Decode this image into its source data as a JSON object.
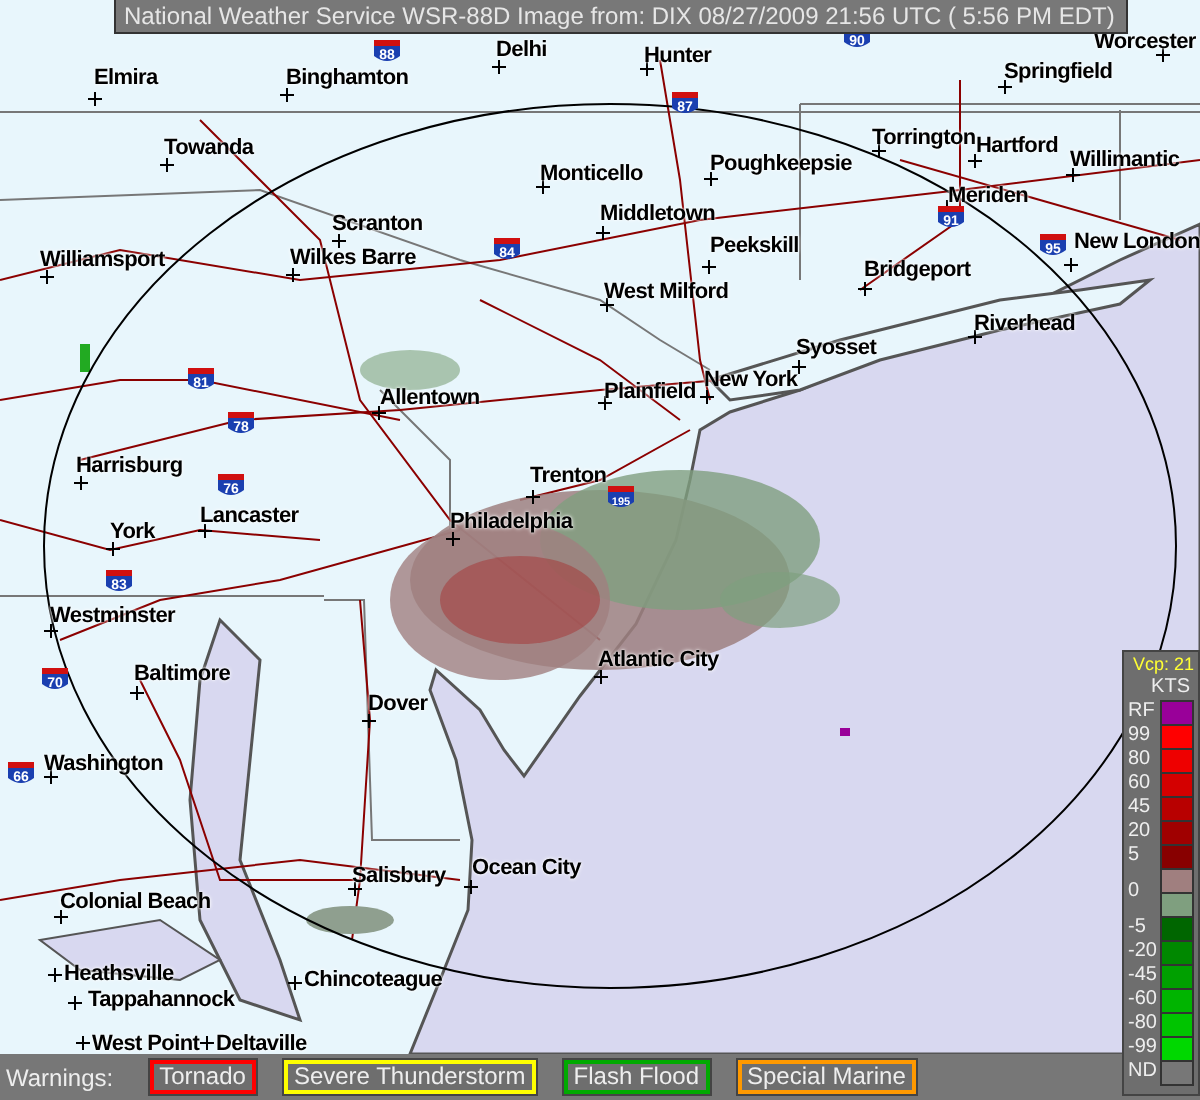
{
  "header": {
    "title": "National Weather Service WSR-88D Image from: DIX 08/27/2009 21:56 UTC ( 5:56 PM EDT)"
  },
  "map": {
    "cities": [
      {
        "name": "Elmira"
      },
      {
        "name": "Binghamton"
      },
      {
        "name": "Delhi"
      },
      {
        "name": "Hunter"
      },
      {
        "name": "Worcester"
      },
      {
        "name": "Springfield"
      },
      {
        "name": "Towanda"
      },
      {
        "name": "Monticello"
      },
      {
        "name": "Poughkeepsie"
      },
      {
        "name": "Torrington"
      },
      {
        "name": "Hartford"
      },
      {
        "name": "Willimantic"
      },
      {
        "name": "Meriden"
      },
      {
        "name": "Middletown"
      },
      {
        "name": "New London"
      },
      {
        "name": "Peekskill"
      },
      {
        "name": "Bridgeport"
      },
      {
        "name": "Riverhead"
      },
      {
        "name": "Scranton"
      },
      {
        "name": "Williamsport"
      },
      {
        "name": "Wilkes Barre"
      },
      {
        "name": "West Milford"
      },
      {
        "name": "Syosset"
      },
      {
        "name": "New York"
      },
      {
        "name": "Plainfield"
      },
      {
        "name": "Allentown"
      },
      {
        "name": "Trenton"
      },
      {
        "name": "Harrisburg"
      },
      {
        "name": "Lancaster"
      },
      {
        "name": "York"
      },
      {
        "name": "Philadelphia"
      },
      {
        "name": "Westminster"
      },
      {
        "name": "Atlantic City"
      },
      {
        "name": "Baltimore"
      },
      {
        "name": "Dover"
      },
      {
        "name": "Washington"
      },
      {
        "name": "Salisbury"
      },
      {
        "name": "Ocean City"
      },
      {
        "name": "Colonial Beach"
      },
      {
        "name": "Chincoteague"
      },
      {
        "name": "Heathsville"
      },
      {
        "name": "Tappahannock"
      },
      {
        "name": "West Point"
      },
      {
        "name": "Deltaville"
      }
    ],
    "shields": [
      {
        "number": "88"
      },
      {
        "number": "90"
      },
      {
        "number": "87"
      },
      {
        "number": "84"
      },
      {
        "number": "91"
      },
      {
        "number": "95"
      },
      {
        "number": "81"
      },
      {
        "number": "78"
      },
      {
        "number": "76"
      },
      {
        "number": "83"
      },
      {
        "number": "70"
      },
      {
        "number": "66"
      },
      {
        "number": "195"
      }
    ]
  },
  "legend": {
    "mode": "Vcp: 21",
    "unit": "KTS",
    "items": [
      {
        "label": "RF",
        "color": "#990099"
      },
      {
        "label": "99",
        "color": "#ff0000"
      },
      {
        "label": "80",
        "color": "#ee0000"
      },
      {
        "label": "60",
        "color": "#d40000"
      },
      {
        "label": "45",
        "color": "#b80000"
      },
      {
        "label": "20",
        "color": "#a00000"
      },
      {
        "label": "5",
        "color": "#880000"
      },
      {
        "label": "0",
        "color": "#a07f7f"
      },
      {
        "color": "#7f9f7f"
      },
      {
        "label": "-5",
        "color": "#006600"
      },
      {
        "label": "-20",
        "color": "#008800"
      },
      {
        "label": "-45",
        "color": "#00a000"
      },
      {
        "label": "-60",
        "color": "#00b400"
      },
      {
        "label": "-80",
        "color": "#00c400"
      },
      {
        "label": "-99",
        "color": "#00d800"
      },
      {
        "label": "ND",
        "color": "#777777"
      }
    ]
  },
  "warnings": {
    "label": "Warnings:",
    "items": [
      {
        "label": "Tornado",
        "color": "#ff0000"
      },
      {
        "label": "Severe Thunderstorm",
        "color": "#ffff00"
      },
      {
        "label": "Flash Flood",
        "color": "#00aa00"
      },
      {
        "label": "Special Marine",
        "color": "#ff9900"
      }
    ]
  }
}
